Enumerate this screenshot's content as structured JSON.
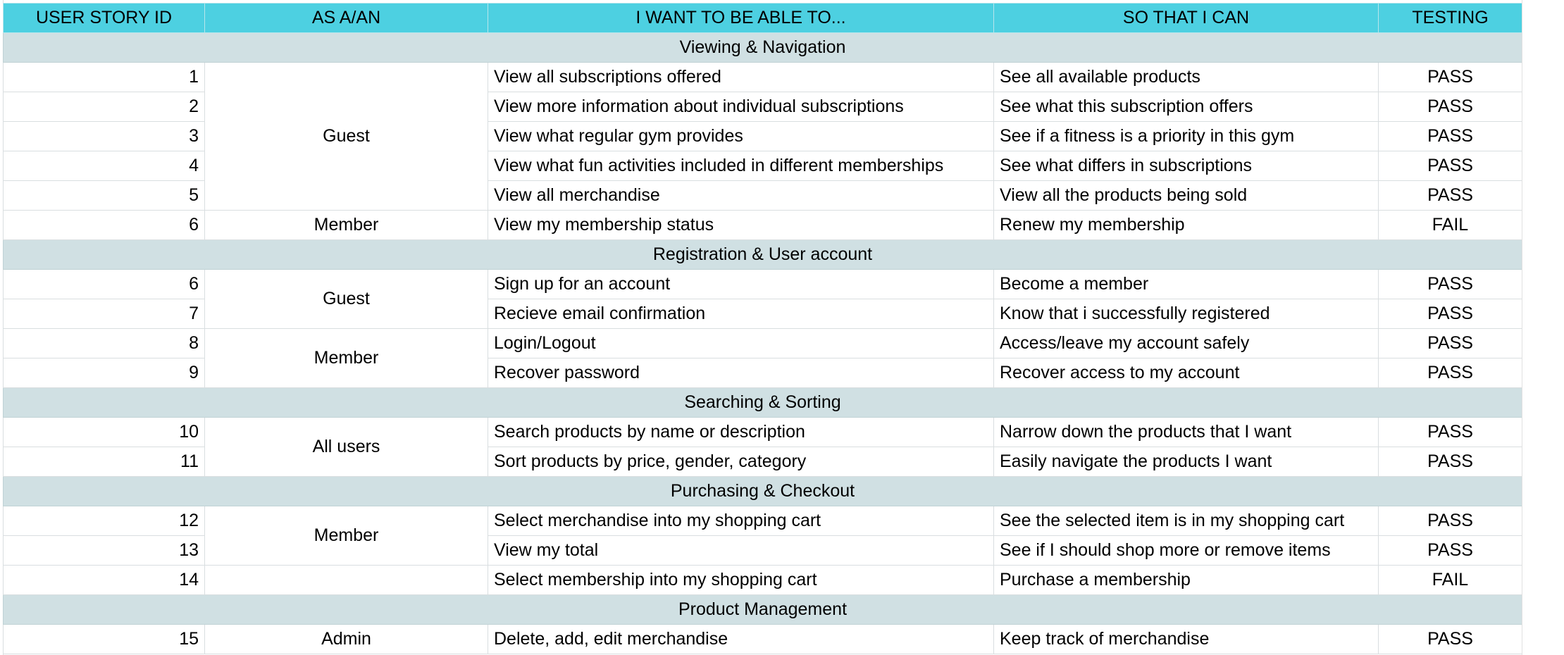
{
  "headers": {
    "id": "USER STORY ID",
    "role": "AS A/AN",
    "want": "I WANT TO BE ABLE TO...",
    "so": "SO THAT I CAN",
    "test": "TESTING"
  },
  "colors": {
    "header_bg": "#4dd0e1",
    "section_bg": "#d0e0e3",
    "grid_line": "#d9dee0"
  },
  "sections": [
    {
      "title": "Viewing & Navigation",
      "rows": [
        {
          "id": "1",
          "want": "View all subscriptions offered",
          "so": "See all available products",
          "test": "PASS"
        },
        {
          "id": "2",
          "want": "View more information about individual subscriptions",
          "so": "See what this subscription offers",
          "test": "PASS"
        },
        {
          "id": "3",
          "want": "View what regular gym provides",
          "so": "See if a fitness is a priority in this gym",
          "test": "PASS"
        },
        {
          "id": "4",
          "want": "View what fun activities included in different memberships",
          "so": "See what differs in subscriptions",
          "test": "PASS"
        },
        {
          "id": "5",
          "want": "View all merchandise",
          "so": "View all the products being sold",
          "test": "PASS"
        },
        {
          "id": "6",
          "want": "View my membership status",
          "so": "Renew my membership",
          "test": "FAIL"
        }
      ],
      "roles": [
        "Guest",
        "Member"
      ]
    },
    {
      "title": "Registration & User account",
      "rows": [
        {
          "id": "6",
          "want": "Sign up for an account",
          "so": "Become a member",
          "test": "PASS"
        },
        {
          "id": "7",
          "want": "Recieve email confirmation",
          "so": "Know that i successfully registered",
          "test": "PASS"
        },
        {
          "id": "8",
          "want": "Login/Logout",
          "so": "Access/leave my account safely",
          "test": "PASS"
        },
        {
          "id": "9",
          "want": "Recover password",
          "so": "Recover access to my account",
          "test": "PASS"
        }
      ],
      "roles": [
        "Guest",
        "Member"
      ]
    },
    {
      "title": "Searching & Sorting",
      "rows": [
        {
          "id": "10",
          "want": "Search products by name or description",
          "so": "Narrow down the products that I want",
          "test": "PASS"
        },
        {
          "id": "11",
          "want": "Sort products by price, gender, category",
          "so": "Easily navigate the products I want",
          "test": "PASS"
        }
      ],
      "roles": [
        "All users"
      ]
    },
    {
      "title": "Purchasing & Checkout",
      "rows": [
        {
          "id": "12",
          "want": "Select merchandise into my shopping cart",
          "so": "See the selected item is in my shopping cart",
          "test": "PASS"
        },
        {
          "id": "13",
          "want": "View my total",
          "so": "See if I should shop more or remove items",
          "test": "PASS"
        },
        {
          "id": "14",
          "want": "Select membership into my shopping cart",
          "so": "Purchase a membership",
          "test": "FAIL"
        }
      ],
      "roles": [
        "Member"
      ]
    },
    {
      "title": "Product Management",
      "rows": [
        {
          "id": "15",
          "want": "Delete, add, edit merchandise",
          "so": "Keep track of merchandise",
          "test": "PASS"
        }
      ],
      "roles": [
        "Admin"
      ]
    }
  ]
}
